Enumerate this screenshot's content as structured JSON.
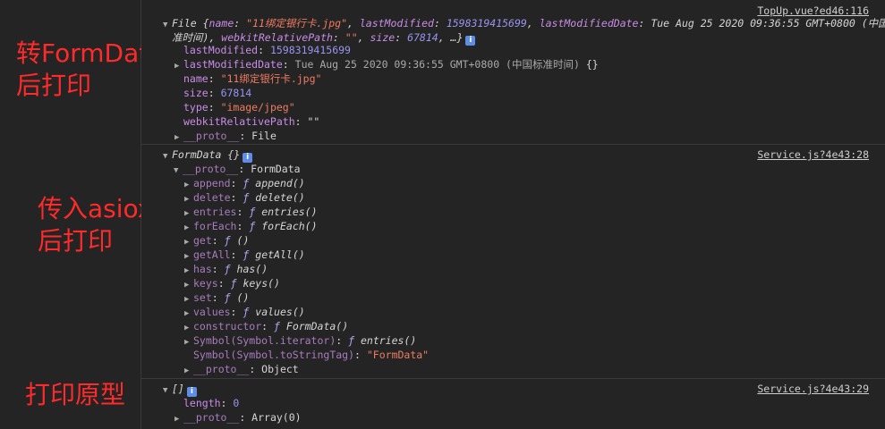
{
  "annotations": {
    "first": [
      "转FormData",
      "后打印"
    ],
    "second": [
      "传入asiox",
      "后打印"
    ],
    "third": "打印原型"
  },
  "messages": {
    "file": {
      "source": "TopUp.vue?ed46:116",
      "summary_line1_prefix": "File {",
      "summary_name_key": "name",
      "summary_name_val": "\"11绑定银行卡.jpg\"",
      "summary_lm_key": "lastModified",
      "summary_lm_val": "1598319415699",
      "summary_lmd_key": "lastModifiedDate",
      "summary_lmd_val": "Tue Aug 25 2020 09:36:55 GMT+0800 (中国标",
      "summary_line2_cont": "准时间)",
      "summary_wrp_key": "webkitRelativePath",
      "summary_wrp_val": "\"\"",
      "summary_size_key": "size",
      "summary_size_val": "67814",
      "summary_end": "…}",
      "props": [
        {
          "key": "lastModified",
          "sep": ": ",
          "value": "1598319415699",
          "kind": "num",
          "expand": false
        },
        {
          "key": "lastModifiedDate",
          "sep": ": ",
          "value": "Tue Aug 25 2020 09:36:55 GMT+0800 (中国标准时间)",
          "extra": " {}",
          "kind": "date",
          "expand": true
        },
        {
          "key": "name",
          "sep": ": ",
          "value": "\"11绑定银行卡.jpg\"",
          "kind": "str",
          "expand": false
        },
        {
          "key": "size",
          "sep": ": ",
          "value": "67814",
          "kind": "num",
          "expand": false
        },
        {
          "key": "type",
          "sep": ": ",
          "value": "\"image/jpeg\"",
          "kind": "str",
          "expand": false
        },
        {
          "key": "webkitRelativePath",
          "sep": ": ",
          "value": "\"\"",
          "kind": "plain",
          "expand": false
        },
        {
          "key": "__proto__",
          "sep": ": ",
          "value": "File",
          "kind": "plain",
          "expand": true,
          "dim": true
        }
      ]
    },
    "formdata": {
      "source": "Service.js?4e43:28",
      "summary": "FormData {}",
      "proto_key": "__proto__",
      "proto_val": "FormData",
      "methods": [
        {
          "key": "append",
          "sig": "append()"
        },
        {
          "key": "delete",
          "sig": "delete()"
        },
        {
          "key": "entries",
          "sig": "entries()"
        },
        {
          "key": "forEach",
          "sig": "forEach()"
        },
        {
          "key": "get",
          "sig": "()"
        },
        {
          "key": "getAll",
          "sig": "getAll()"
        },
        {
          "key": "has",
          "sig": "has()"
        },
        {
          "key": "keys",
          "sig": "keys()"
        },
        {
          "key": "set",
          "sig": "()"
        },
        {
          "key": "values",
          "sig": "values()"
        },
        {
          "key": "constructor",
          "sig": "FormData()"
        },
        {
          "key": "Symbol(Symbol.iterator)",
          "sig": "entries()"
        }
      ],
      "tostringtag_key": "Symbol(Symbol.toStringTag)",
      "tostringtag_val": "\"FormData\"",
      "inner_proto_key": "__proto__",
      "inner_proto_val": "Object",
      "f_glyph": "ƒ"
    },
    "array": {
      "source": "Service.js?4e43:29",
      "summary": "[]",
      "length_key": "length",
      "length_val": "0",
      "proto_key": "__proto__",
      "proto_val": "Array(0)"
    },
    "info_glyph": "i",
    "triangle_down": "▼",
    "triangle_right": "▶"
  },
  "colors": {
    "annotation": "#ff2a2a",
    "background": "#242424",
    "key": "#ca8ce7",
    "string": "#ee7b61",
    "number": "#9b93f0",
    "info_badge": "#5e8de8"
  }
}
